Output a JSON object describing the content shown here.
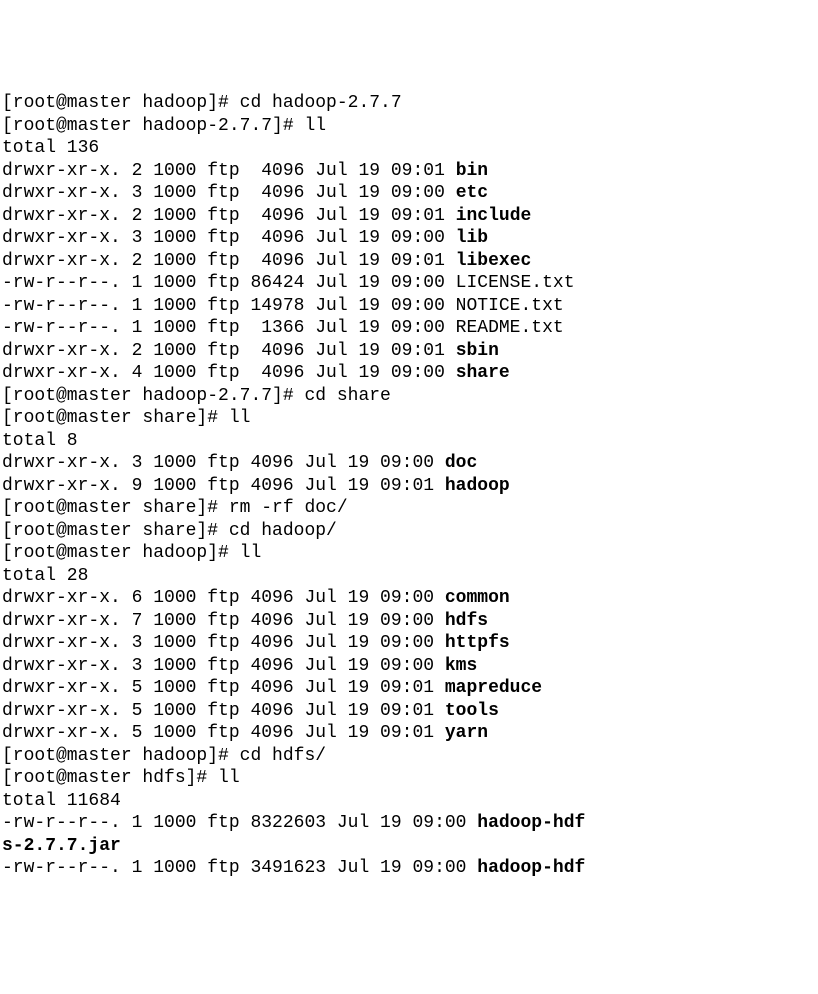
{
  "lines": [
    {
      "segments": [
        {
          "t": "[root@master hadoop]# cd hadoop-2.7.7"
        }
      ]
    },
    {
      "segments": [
        {
          "t": "[root@master hadoop-2.7.7]# ll"
        }
      ]
    },
    {
      "segments": [
        {
          "t": "total 136"
        }
      ]
    },
    {
      "segments": [
        {
          "t": "drwxr-xr-x. 2 1000 ftp  4096 Jul 19 09:01 "
        },
        {
          "t": "bin",
          "b": true
        }
      ]
    },
    {
      "segments": [
        {
          "t": "drwxr-xr-x. 3 1000 ftp  4096 Jul 19 09:00 "
        },
        {
          "t": "etc",
          "b": true
        }
      ]
    },
    {
      "segments": [
        {
          "t": "drwxr-xr-x. 2 1000 ftp  4096 Jul 19 09:01 "
        },
        {
          "t": "include",
          "b": true
        }
      ]
    },
    {
      "segments": [
        {
          "t": "drwxr-xr-x. 3 1000 ftp  4096 Jul 19 09:00 "
        },
        {
          "t": "lib",
          "b": true
        }
      ]
    },
    {
      "segments": [
        {
          "t": "drwxr-xr-x. 2 1000 ftp  4096 Jul 19 09:01 "
        },
        {
          "t": "libexec",
          "b": true
        }
      ]
    },
    {
      "segments": [
        {
          "t": "-rw-r--r--. 1 1000 ftp 86424 Jul 19 09:00 LICENSE.txt"
        }
      ]
    },
    {
      "segments": [
        {
          "t": "-rw-r--r--. 1 1000 ftp 14978 Jul 19 09:00 NOTICE.txt"
        }
      ]
    },
    {
      "segments": [
        {
          "t": "-rw-r--r--. 1 1000 ftp  1366 Jul 19 09:00 README.txt"
        }
      ]
    },
    {
      "segments": [
        {
          "t": "drwxr-xr-x. 2 1000 ftp  4096 Jul 19 09:01 "
        },
        {
          "t": "sbin",
          "b": true
        }
      ]
    },
    {
      "segments": [
        {
          "t": "drwxr-xr-x. 4 1000 ftp  4096 Jul 19 09:00 "
        },
        {
          "t": "share",
          "b": true
        }
      ]
    },
    {
      "segments": [
        {
          "t": "[root@master hadoop-2.7.7]# cd share"
        }
      ]
    },
    {
      "segments": [
        {
          "t": "[root@master share]# ll"
        }
      ]
    },
    {
      "segments": [
        {
          "t": "total 8"
        }
      ]
    },
    {
      "segments": [
        {
          "t": "drwxr-xr-x. 3 1000 ftp 4096 Jul 19 09:00 "
        },
        {
          "t": "doc",
          "b": true
        }
      ]
    },
    {
      "segments": [
        {
          "t": "drwxr-xr-x. 9 1000 ftp 4096 Jul 19 09:01 "
        },
        {
          "t": "hadoop",
          "b": true
        }
      ]
    },
    {
      "segments": [
        {
          "t": "[root@master share]# rm -rf doc/"
        }
      ]
    },
    {
      "segments": [
        {
          "t": "[root@master share]# cd hadoop/"
        }
      ]
    },
    {
      "segments": [
        {
          "t": "[root@master hadoop]# ll"
        }
      ]
    },
    {
      "segments": [
        {
          "t": "total 28"
        }
      ]
    },
    {
      "segments": [
        {
          "t": "drwxr-xr-x. 6 1000 ftp 4096 Jul 19 09:00 "
        },
        {
          "t": "common",
          "b": true
        }
      ]
    },
    {
      "segments": [
        {
          "t": "drwxr-xr-x. 7 1000 ftp 4096 Jul 19 09:00 "
        },
        {
          "t": "hdfs",
          "b": true
        }
      ]
    },
    {
      "segments": [
        {
          "t": "drwxr-xr-x. 3 1000 ftp 4096 Jul 19 09:00 "
        },
        {
          "t": "httpfs",
          "b": true
        }
      ]
    },
    {
      "segments": [
        {
          "t": "drwxr-xr-x. 3 1000 ftp 4096 Jul 19 09:00 "
        },
        {
          "t": "kms",
          "b": true
        }
      ]
    },
    {
      "segments": [
        {
          "t": "drwxr-xr-x. 5 1000 ftp 4096 Jul 19 09:01 "
        },
        {
          "t": "mapreduce",
          "b": true
        }
      ]
    },
    {
      "segments": [
        {
          "t": "drwxr-xr-x. 5 1000 ftp 4096 Jul 19 09:01 "
        },
        {
          "t": "tools",
          "b": true
        }
      ]
    },
    {
      "segments": [
        {
          "t": "drwxr-xr-x. 5 1000 ftp 4096 Jul 19 09:01 "
        },
        {
          "t": "yarn",
          "b": true
        }
      ]
    },
    {
      "segments": [
        {
          "t": "[root@master hadoop]# cd hdfs/"
        }
      ]
    },
    {
      "segments": [
        {
          "t": "[root@master hdfs]# ll"
        }
      ]
    },
    {
      "segments": [
        {
          "t": "total 11684"
        }
      ]
    },
    {
      "segments": [
        {
          "t": "-rw-r--r--. 1 1000 ftp 8322603 Jul 19 09:00 "
        },
        {
          "t": "hadoop-hdf",
          "b": true
        }
      ]
    },
    {
      "segments": [
        {
          "t": "s-2.7.7.jar",
          "b": true
        }
      ]
    },
    {
      "segments": [
        {
          "t": "-rw-r--r--. 1 1000 ftp 3491623 Jul 19 09:00 "
        },
        {
          "t": "hadoop-hdf",
          "b": true
        }
      ]
    }
  ]
}
